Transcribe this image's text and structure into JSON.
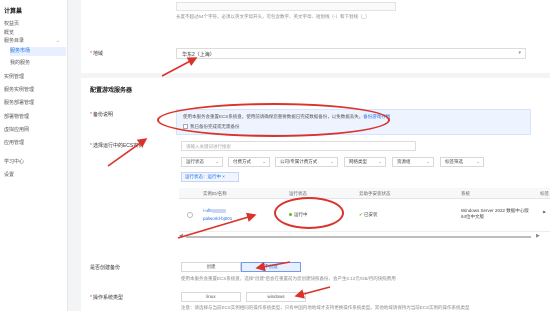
{
  "sidebar": {
    "title": "计算巢",
    "items": [
      {
        "label": "权益页",
        "level": 1
      },
      {
        "label": "概览",
        "level": 1
      },
      {
        "label": "服务目录",
        "level": 1,
        "expandable": true
      },
      {
        "label": "服务市场",
        "level": 2,
        "active": true
      },
      {
        "label": "我的服务",
        "level": 2
      },
      {
        "label": "实例管理",
        "level": 1
      },
      {
        "label": "服务实例管理",
        "level": 1
      },
      {
        "label": "服务部署管理",
        "level": 1
      },
      {
        "label": "部署物管理",
        "level": 1
      },
      {
        "label": "虚拟应用网",
        "level": 1
      },
      {
        "label": "应用管理",
        "level": 1
      },
      {
        "label": "学习中心",
        "level": 1
      },
      {
        "label": "设置",
        "level": 1
      }
    ]
  },
  "form": {
    "top_hint": "长度不超过64个字符，必须以英文字母开头，可包含数字、英文字母、短划线（-）和下划线（_）",
    "region_label": "地域",
    "region_value": "华东2（上海）",
    "section_title": "配置游戏服务器",
    "backup_label": "备份说明",
    "backup_warning": "使用本服务会重置ECS系统盘，使用前请确保您重要数据已完成数据备份，以免数据丢失。",
    "backup_link": "备份游戏存档",
    "backup_checkbox_label": "我已备份完成或无需备份",
    "ecs_label": "选择运行中的ECS实例",
    "search_placeholder": "请输入关键词进行搜索",
    "filters": [
      "运行状态",
      "付费方式",
      "公司/专属计费方式",
      "网络类型",
      "资源组",
      "标签筛选"
    ],
    "active_tag": "运行状态：运行中",
    "table": {
      "headers": [
        "实例ID/名称",
        "运行状态",
        "云助手安装状态",
        "系统",
        "标签"
      ],
      "row": {
        "id": "i-uf6",
        "name": "palworld-bj001",
        "status": "运行中",
        "assistant": "已安装",
        "os": "Windows Server 2022 数据中心版 64位中文版"
      }
    },
    "backup_create_label": "是否创建备份",
    "backup_options": [
      "创建",
      "不创建"
    ],
    "backup_selected": "不创建",
    "backup_hint": "使用本服务会重置ECS系统盘，选择\"创建\"后会在重置前为您创建快照备份，会产生0.12元/GB/月的快照费用",
    "os_label": "操作系统类型",
    "os_options": [
      "linux",
      "windows"
    ],
    "os_hint": "注意：请选择与当前ECS实例相同的操作系统类型，只有中国内地地域才支持更换操作系统类型。其他地域请保持为当前ECS实例的操作系统类型"
  },
  "colors": {
    "accent": "#1f6fe5",
    "annotation": "#d9342b",
    "status_running": "#52c41a"
  }
}
